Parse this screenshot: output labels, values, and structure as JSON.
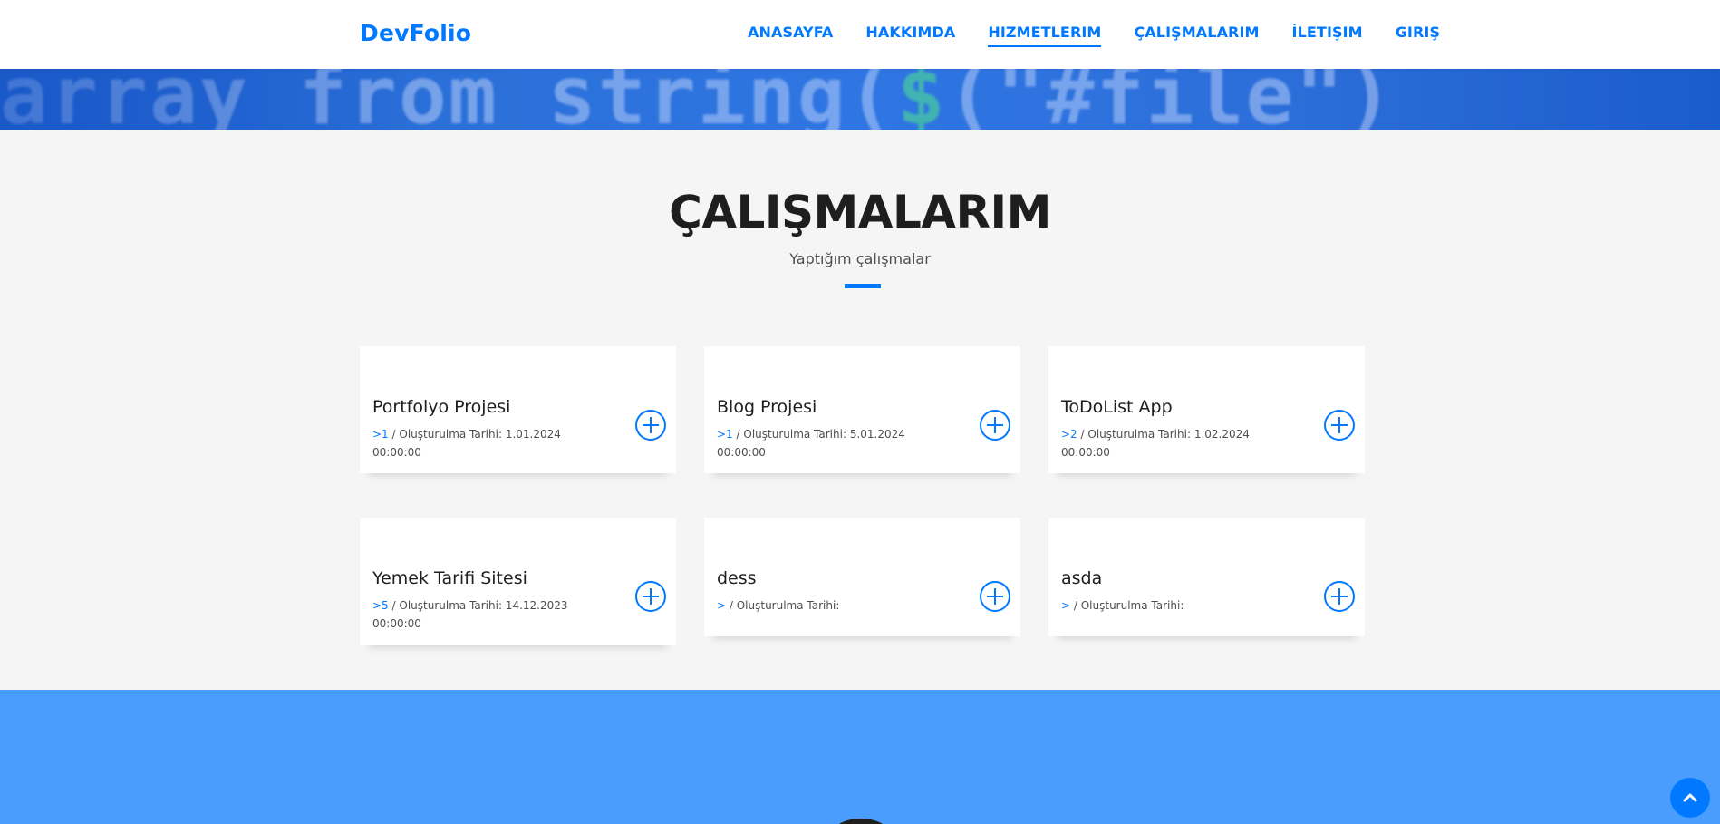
{
  "brand": "DevFolio",
  "nav": [
    {
      "label": "ANASAYFA"
    },
    {
      "label": "HAKKIMDA"
    },
    {
      "label": "HIZMETLERIM",
      "active": true
    },
    {
      "label": "ÇALIŞMALARIM"
    },
    {
      "label": "İLETIŞIM"
    },
    {
      "label": "GIRIŞ"
    }
  ],
  "banner": {
    "text_part1": "array_from_string(",
    "text_part2": "$",
    "text_part3": "(\"#file\")"
  },
  "section": {
    "title": "ÇALIŞMALARIM",
    "subtitle": "Yaptığım çalışmalar"
  },
  "colors": {
    "accent": "#0078ff",
    "blue_section": "#4a9dfc",
    "page_bg": "#f5f5f5"
  },
  "works": [
    {
      "title": "Portfolyo Projesi",
      "category": ">1",
      "date_label": " / Oluşturulma Tarihi: ",
      "date": "1.01.2024 00:00:00"
    },
    {
      "title": "Blog Projesi",
      "category": ">1",
      "date_label": " / Oluşturulma Tarihi: ",
      "date": "5.01.2024 00:00:00"
    },
    {
      "title": "ToDoList App",
      "category": ">2",
      "date_label": " / Oluşturulma Tarihi: ",
      "date": "1.02.2024 00:00:00"
    },
    {
      "title": "Yemek Tarifi Sitesi",
      "category": ">5",
      "date_label": " / Oluşturulma Tarihi: ",
      "date": "14.12.2023 00:00:00"
    },
    {
      "title": "dess",
      "category": ">",
      "date_label": " / Oluşturulma Tarihi:",
      "date": ""
    },
    {
      "title": "asda",
      "category": ">",
      "date_label": " / Oluşturulma Tarihi:",
      "date": ""
    }
  ],
  "icons": {
    "card_action": "plus-circle-icon",
    "back_to_top": "chevron-up-icon"
  }
}
